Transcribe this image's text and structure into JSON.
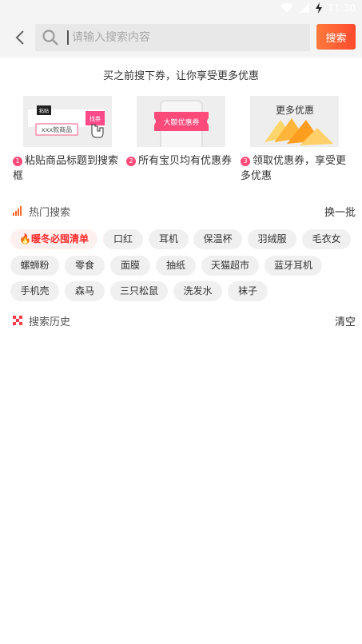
{
  "status_bar": {
    "time": "11:30"
  },
  "header": {
    "search_placeholder": "请输入搜索内容",
    "search_button": "搜索"
  },
  "guide": {
    "title": "买之前搜下券，让你享受更多优惠",
    "img1": {
      "label1": "粘贴",
      "label2": "xxx款商品",
      "label3": "找券"
    },
    "img2": {
      "label": "大额优惠券"
    },
    "img3": {
      "label": "更多优惠"
    },
    "steps": [
      {
        "num": "1",
        "text": "粘贴商品标题到搜索框"
      },
      {
        "num": "2",
        "text": "所有宝贝均有优惠券"
      },
      {
        "num": "3",
        "text": "领取优惠券，享受更多优惠"
      }
    ]
  },
  "hot_search": {
    "title": "热门搜索",
    "action": "换一批",
    "tags": [
      "暖冬必囤清单",
      "口红",
      "耳机",
      "保温杯",
      "羽绒服",
      "毛衣女",
      "螺蛳粉",
      "零食",
      "面膜",
      "抽纸",
      "天猫超市",
      "蓝牙耳机",
      "手机壳",
      "森马",
      "三只松鼠",
      "洗发水",
      "袜子"
    ]
  },
  "history": {
    "title": "搜索历史",
    "action": "清空"
  },
  "colors": {
    "accent": "#ff4a2e",
    "hot_tag": "#ff2a2a",
    "step_badge": "#ff4a7a"
  }
}
